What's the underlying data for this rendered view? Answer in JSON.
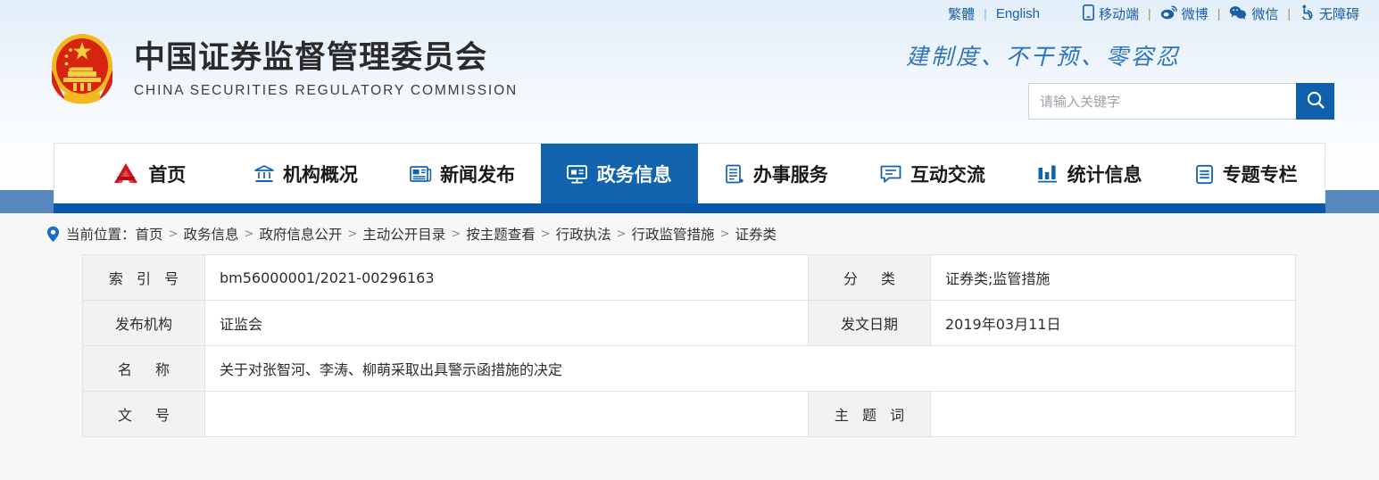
{
  "topbar": {
    "lang": [
      {
        "label": "繁體",
        "name": "traditional-chinese-link"
      },
      {
        "label": "English",
        "name": "english-link"
      }
    ],
    "separator": "|",
    "links": [
      {
        "label": "移动端",
        "icon": "mobile-icon",
        "glyph": "▯"
      },
      {
        "label": "微博",
        "icon": "weibo-icon",
        "glyph": "◉"
      },
      {
        "label": "微信",
        "icon": "wechat-icon",
        "glyph": "◍"
      },
      {
        "label": "无障碍",
        "icon": "accessibility-icon",
        "glyph": "♿"
      }
    ]
  },
  "brand": {
    "emblem": "national-emblem",
    "title_cn": "中国证券监督管理委员会",
    "title_en": "CHINA SECURITIES REGULATORY COMMISSION",
    "slogan": "建制度、不干预、零容忍"
  },
  "search": {
    "placeholder": "请输入关键字",
    "value": "",
    "button_icon": "search-icon"
  },
  "nav": {
    "items": [
      {
        "label": "首页",
        "icon": "home-logo-icon",
        "active": false
      },
      {
        "label": "机构概况",
        "icon": "institution-icon",
        "active": false
      },
      {
        "label": "新闻发布",
        "icon": "news-icon",
        "active": false
      },
      {
        "label": "政务信息",
        "icon": "government-affairs-icon",
        "active": true
      },
      {
        "label": "办事服务",
        "icon": "services-icon",
        "active": false
      },
      {
        "label": "互动交流",
        "icon": "interaction-icon",
        "active": false
      },
      {
        "label": "统计信息",
        "icon": "statistics-icon",
        "active": false
      },
      {
        "label": "专题专栏",
        "icon": "topics-icon",
        "active": false
      }
    ]
  },
  "breadcrumb": {
    "icon": "location-pin-icon",
    "prefix": "当前位置：",
    "separator": ">",
    "items": [
      "首页",
      "政务信息",
      "政府信息公开",
      "主动公开目录",
      "按主题查看",
      "行政执法",
      "行政监管措施",
      "证券类"
    ]
  },
  "meta_table": {
    "rows": [
      {
        "left_label": "索 引 号",
        "left_value": "bm56000001/2021-00296163",
        "right_label": "分　类",
        "right_value": "证券类;监管措施"
      },
      {
        "left_label": "发布机构",
        "left_value": "证监会",
        "right_label": "发文日期",
        "right_value": "2019年03月11日"
      },
      {
        "left_label": "名　称",
        "left_value": "关于对张智河、李涛、柳萌采取出具警示函措施的决定",
        "right_label": "",
        "right_value": ""
      },
      {
        "left_label": "文　号",
        "left_value": "",
        "right_label": "主 题 词",
        "right_value": ""
      }
    ]
  },
  "colors": {
    "nav_active": "#1263ad",
    "nav_underline": "#0a59a8",
    "nav_band": "#5789bf",
    "link_blue": "#1a5fa8",
    "search_button": "#0f5fac"
  }
}
